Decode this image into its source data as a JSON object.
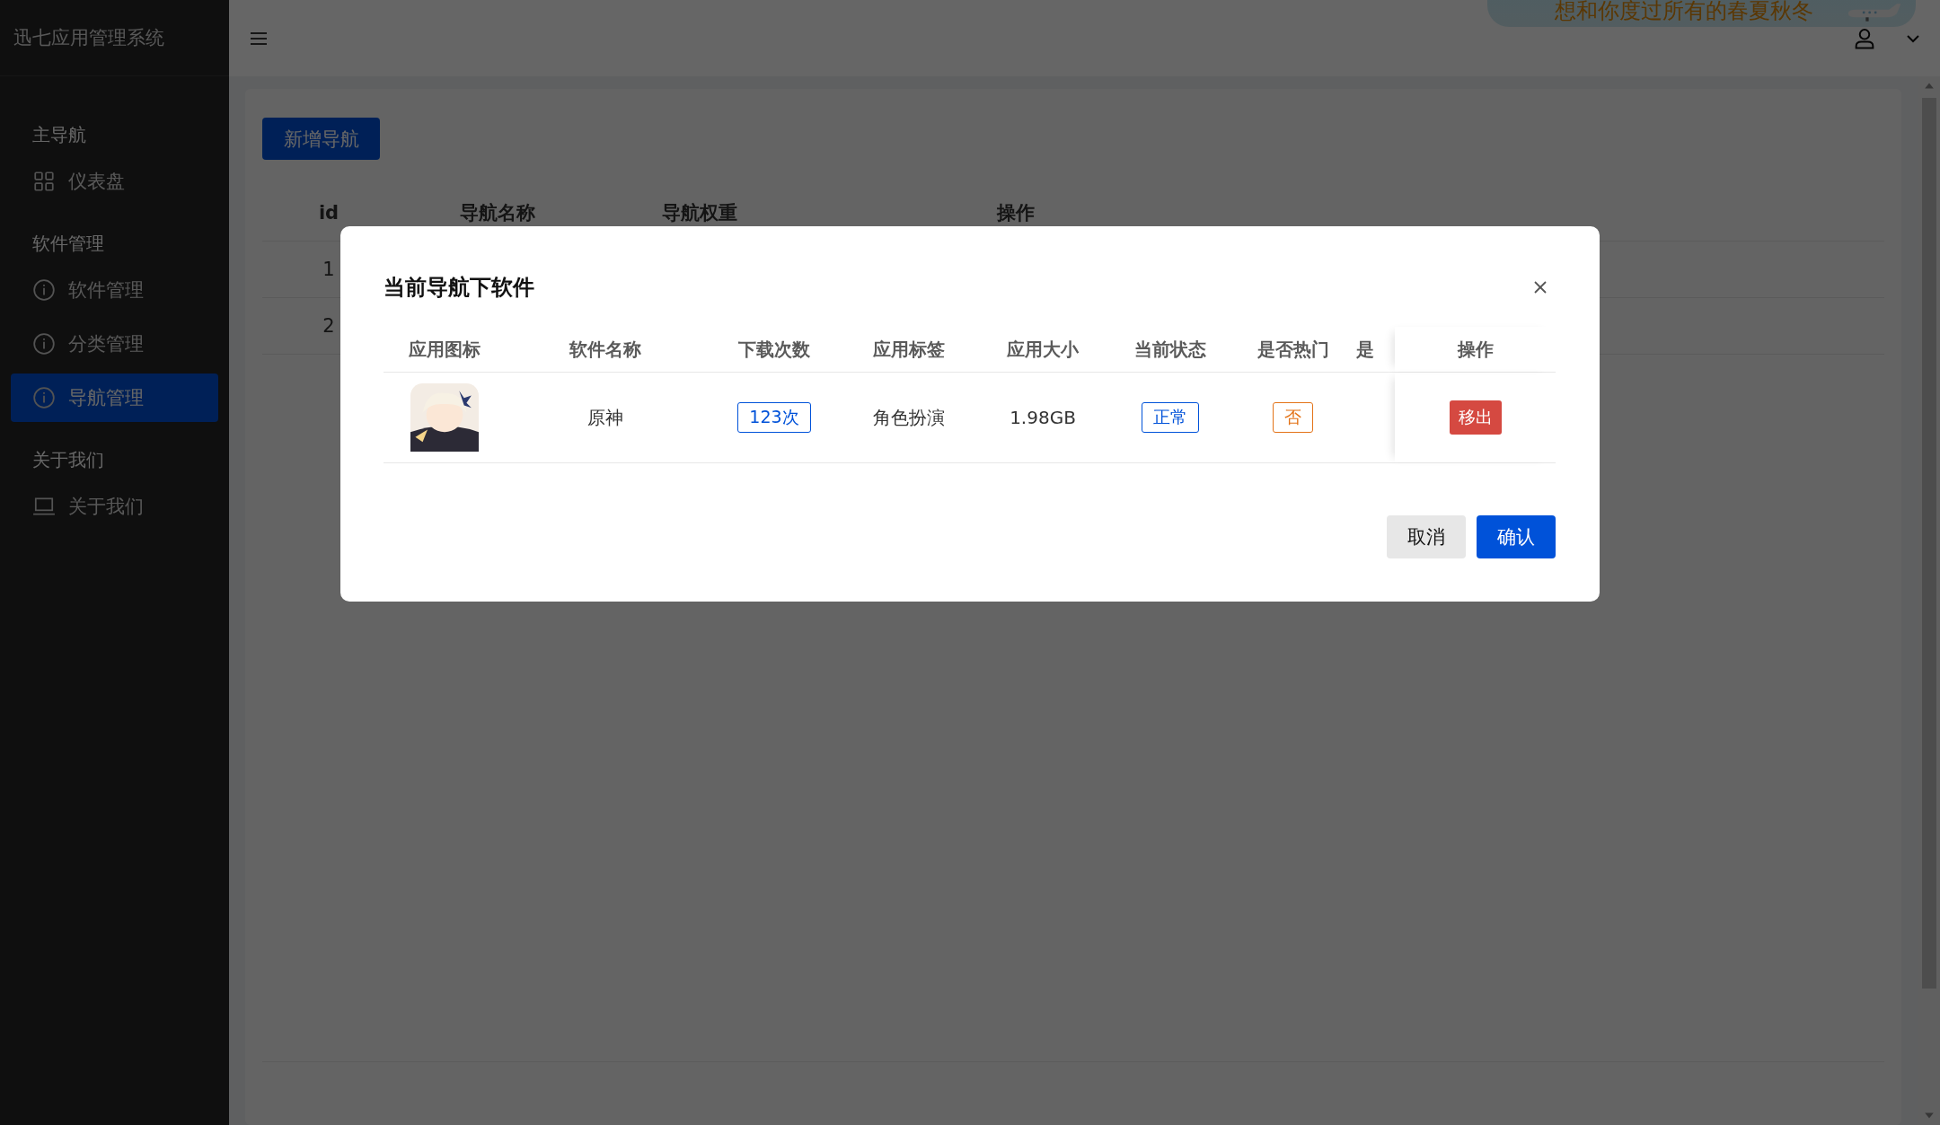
{
  "app": {
    "title": "迅七应用管理系统"
  },
  "sidebar": {
    "groups": [
      {
        "label": "主导航",
        "items": [
          {
            "label": "仪表盘",
            "kind": "grid",
            "selected": false
          }
        ]
      },
      {
        "label": "软件管理",
        "items": [
          {
            "label": "软件管理",
            "kind": "info",
            "selected": false
          },
          {
            "label": "分类管理",
            "kind": "info",
            "selected": false
          },
          {
            "label": "导航管理",
            "kind": "info",
            "selected": true
          }
        ]
      },
      {
        "label": "关于我们",
        "items": [
          {
            "label": "关于我们",
            "kind": "laptop",
            "selected": false
          }
        ]
      }
    ]
  },
  "header": {
    "banner": "想和你度过所有的春夏秋冬"
  },
  "page": {
    "add_button": "新增导航",
    "table": {
      "columns": [
        "id",
        "导航名称",
        "导航权重",
        "操作"
      ],
      "rows": [
        {
          "id": "1"
        },
        {
          "id": "2"
        }
      ]
    }
  },
  "dialog": {
    "title": "当前导航下软件",
    "columns": [
      "应用图标",
      "软件名称",
      "下载次数",
      "应用标签",
      "应用大小",
      "当前状态",
      "是否热门",
      "是",
      "操作"
    ],
    "rows": [
      {
        "name": "原神",
        "downloads": "123次",
        "tag": "角色扮演",
        "size": "1.98GB",
        "status": "正常",
        "hot": "否",
        "action": "移出"
      }
    ],
    "buttons": [
      {
        "label": "取消",
        "kind": "default"
      },
      {
        "label": "确认",
        "kind": "primary"
      }
    ]
  }
}
